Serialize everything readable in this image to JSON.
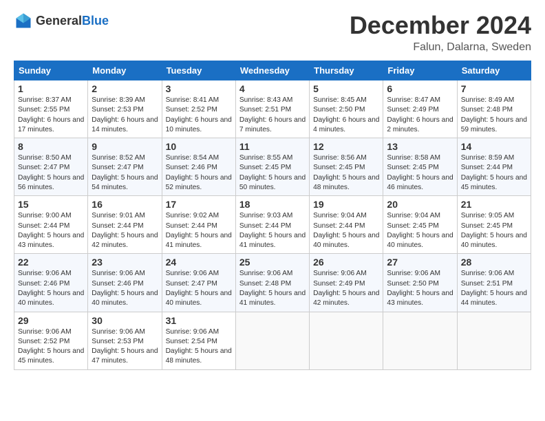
{
  "header": {
    "logo_general": "General",
    "logo_blue": "Blue",
    "month_title": "December 2024",
    "location": "Falun, Dalarna, Sweden"
  },
  "columns": [
    "Sunday",
    "Monday",
    "Tuesday",
    "Wednesday",
    "Thursday",
    "Friday",
    "Saturday"
  ],
  "weeks": [
    [
      {
        "day": "1",
        "info": "Sunrise: 8:37 AM\nSunset: 2:55 PM\nDaylight: 6 hours and 17 minutes."
      },
      {
        "day": "2",
        "info": "Sunrise: 8:39 AM\nSunset: 2:53 PM\nDaylight: 6 hours and 14 minutes."
      },
      {
        "day": "3",
        "info": "Sunrise: 8:41 AM\nSunset: 2:52 PM\nDaylight: 6 hours and 10 minutes."
      },
      {
        "day": "4",
        "info": "Sunrise: 8:43 AM\nSunset: 2:51 PM\nDaylight: 6 hours and 7 minutes."
      },
      {
        "day": "5",
        "info": "Sunrise: 8:45 AM\nSunset: 2:50 PM\nDaylight: 6 hours and 4 minutes."
      },
      {
        "day": "6",
        "info": "Sunrise: 8:47 AM\nSunset: 2:49 PM\nDaylight: 6 hours and 2 minutes."
      },
      {
        "day": "7",
        "info": "Sunrise: 8:49 AM\nSunset: 2:48 PM\nDaylight: 5 hours and 59 minutes."
      }
    ],
    [
      {
        "day": "8",
        "info": "Sunrise: 8:50 AM\nSunset: 2:47 PM\nDaylight: 5 hours and 56 minutes."
      },
      {
        "day": "9",
        "info": "Sunrise: 8:52 AM\nSunset: 2:47 PM\nDaylight: 5 hours and 54 minutes."
      },
      {
        "day": "10",
        "info": "Sunrise: 8:54 AM\nSunset: 2:46 PM\nDaylight: 5 hours and 52 minutes."
      },
      {
        "day": "11",
        "info": "Sunrise: 8:55 AM\nSunset: 2:45 PM\nDaylight: 5 hours and 50 minutes."
      },
      {
        "day": "12",
        "info": "Sunrise: 8:56 AM\nSunset: 2:45 PM\nDaylight: 5 hours and 48 minutes."
      },
      {
        "day": "13",
        "info": "Sunrise: 8:58 AM\nSunset: 2:45 PM\nDaylight: 5 hours and 46 minutes."
      },
      {
        "day": "14",
        "info": "Sunrise: 8:59 AM\nSunset: 2:44 PM\nDaylight: 5 hours and 45 minutes."
      }
    ],
    [
      {
        "day": "15",
        "info": "Sunrise: 9:00 AM\nSunset: 2:44 PM\nDaylight: 5 hours and 43 minutes."
      },
      {
        "day": "16",
        "info": "Sunrise: 9:01 AM\nSunset: 2:44 PM\nDaylight: 5 hours and 42 minutes."
      },
      {
        "day": "17",
        "info": "Sunrise: 9:02 AM\nSunset: 2:44 PM\nDaylight: 5 hours and 41 minutes."
      },
      {
        "day": "18",
        "info": "Sunrise: 9:03 AM\nSunset: 2:44 PM\nDaylight: 5 hours and 41 minutes."
      },
      {
        "day": "19",
        "info": "Sunrise: 9:04 AM\nSunset: 2:44 PM\nDaylight: 5 hours and 40 minutes."
      },
      {
        "day": "20",
        "info": "Sunrise: 9:04 AM\nSunset: 2:45 PM\nDaylight: 5 hours and 40 minutes."
      },
      {
        "day": "21",
        "info": "Sunrise: 9:05 AM\nSunset: 2:45 PM\nDaylight: 5 hours and 40 minutes."
      }
    ],
    [
      {
        "day": "22",
        "info": "Sunrise: 9:06 AM\nSunset: 2:46 PM\nDaylight: 5 hours and 40 minutes."
      },
      {
        "day": "23",
        "info": "Sunrise: 9:06 AM\nSunset: 2:46 PM\nDaylight: 5 hours and 40 minutes."
      },
      {
        "day": "24",
        "info": "Sunrise: 9:06 AM\nSunset: 2:47 PM\nDaylight: 5 hours and 40 minutes."
      },
      {
        "day": "25",
        "info": "Sunrise: 9:06 AM\nSunset: 2:48 PM\nDaylight: 5 hours and 41 minutes."
      },
      {
        "day": "26",
        "info": "Sunrise: 9:06 AM\nSunset: 2:49 PM\nDaylight: 5 hours and 42 minutes."
      },
      {
        "day": "27",
        "info": "Sunrise: 9:06 AM\nSunset: 2:50 PM\nDaylight: 5 hours and 43 minutes."
      },
      {
        "day": "28",
        "info": "Sunrise: 9:06 AM\nSunset: 2:51 PM\nDaylight: 5 hours and 44 minutes."
      }
    ],
    [
      {
        "day": "29",
        "info": "Sunrise: 9:06 AM\nSunset: 2:52 PM\nDaylight: 5 hours and 45 minutes."
      },
      {
        "day": "30",
        "info": "Sunrise: 9:06 AM\nSunset: 2:53 PM\nDaylight: 5 hours and 47 minutes."
      },
      {
        "day": "31",
        "info": "Sunrise: 9:06 AM\nSunset: 2:54 PM\nDaylight: 5 hours and 48 minutes."
      },
      {
        "day": "",
        "info": ""
      },
      {
        "day": "",
        "info": ""
      },
      {
        "day": "",
        "info": ""
      },
      {
        "day": "",
        "info": ""
      }
    ]
  ]
}
